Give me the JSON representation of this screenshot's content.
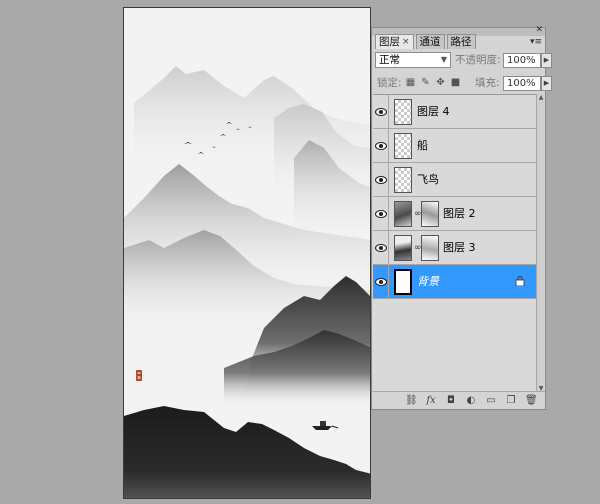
{
  "panel": {
    "tabs": [
      {
        "label": "图层",
        "active": true,
        "closable": true
      },
      {
        "label": "通道",
        "active": false
      },
      {
        "label": "路径",
        "active": false
      }
    ],
    "blend_mode": "正常",
    "opacity_label": "不透明度:",
    "opacity_value": "100%",
    "lock_label": "锁定:",
    "fill_label": "填充:",
    "fill_value": "100%"
  },
  "layers": [
    {
      "name": "图层 4",
      "visible": true,
      "thumb": "transparent"
    },
    {
      "name": "船",
      "visible": true,
      "thumb": "transparent"
    },
    {
      "name": "飞鸟",
      "visible": true,
      "thumb": "transparent"
    },
    {
      "name": "图层 2",
      "visible": true,
      "thumb": "mountain-with-mask"
    },
    {
      "name": "图层 3",
      "visible": true,
      "thumb": "mountain-with-mask"
    },
    {
      "name": "背景",
      "visible": true,
      "thumb": "white",
      "selected": true,
      "locked": true
    }
  ],
  "icons": {
    "eye": "eye-icon",
    "link": "link-layers-icon",
    "fx": "layer-style-icon",
    "mask": "add-mask-icon",
    "adjust": "adjustment-layer-icon",
    "group": "new-group-icon",
    "new": "new-layer-icon",
    "trash": "delete-layer-icon"
  },
  "colors": {
    "selection": "#3399ff",
    "panel_bg": "#d4d4d4",
    "workspace": "#a9a9a9"
  }
}
